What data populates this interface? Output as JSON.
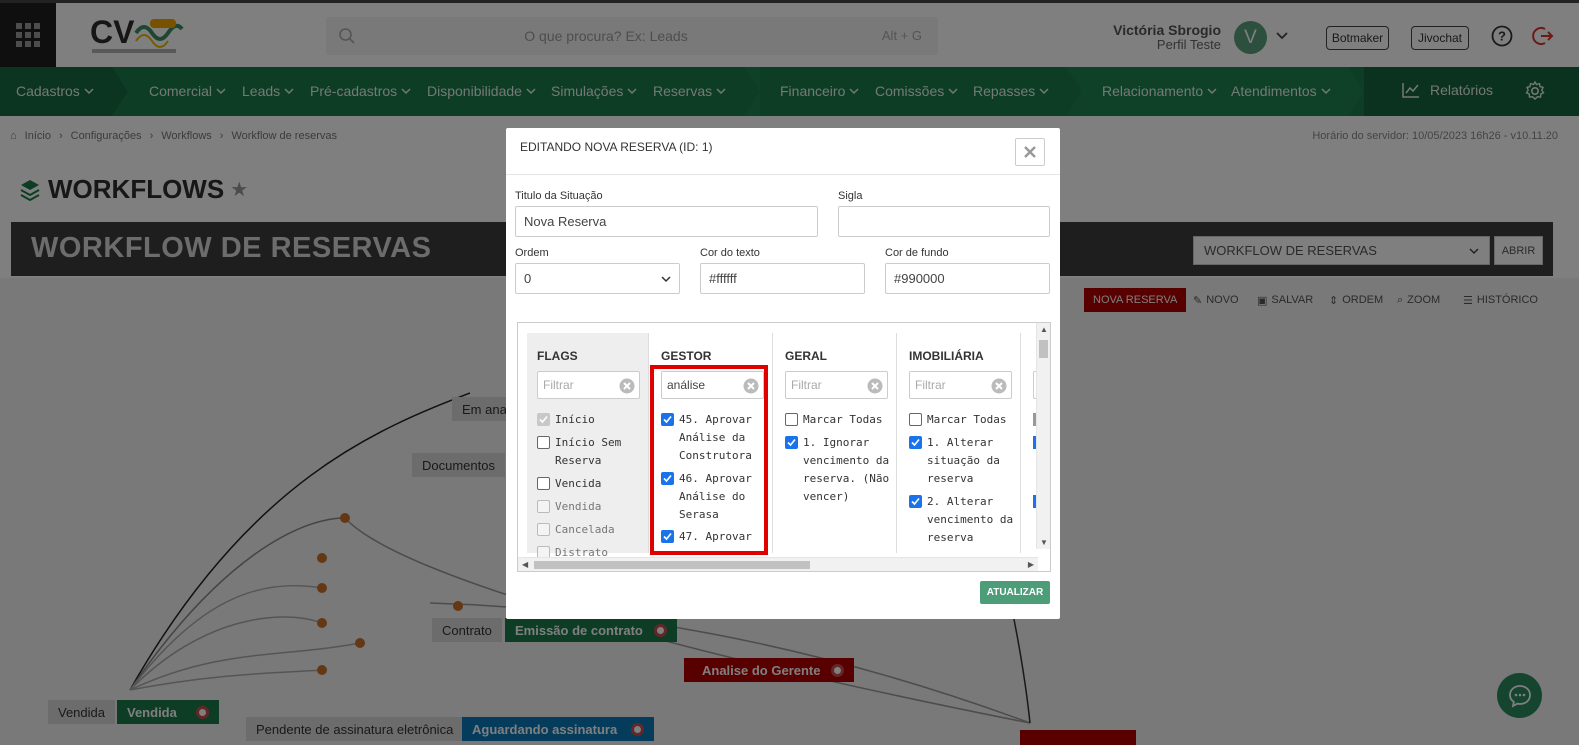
{
  "header": {
    "search_placeholder": "O que procura? Ex: Leads",
    "search_shortcut": "Alt + G",
    "user_name": "Victória Sbrogio",
    "user_profile": "Perfil Teste",
    "avatar_letter": "V",
    "botmaker_label": "Botmaker",
    "jivochat_label": "Jivochat"
  },
  "nav": {
    "items": [
      {
        "label": "Cadastros"
      },
      {
        "label": "Comercial"
      },
      {
        "label": "Leads"
      },
      {
        "label": "Pré-cadastros"
      },
      {
        "label": "Disponibilidade"
      },
      {
        "label": "Simulações"
      },
      {
        "label": "Reservas"
      },
      {
        "label": "Financeiro"
      },
      {
        "label": "Comissões"
      },
      {
        "label": "Repasses"
      },
      {
        "label": "Relacionamento"
      },
      {
        "label": "Atendimentos"
      }
    ],
    "reports_label": "Relatórios",
    "accent_color": "#1b7a4a"
  },
  "breadcrumb": {
    "items": [
      "Início",
      "Configurações",
      "Workflows",
      "Workflow de reservas"
    ]
  },
  "server_time": "Horário do servidor: 10/05/2023 16h26 - v10.11.20",
  "page": {
    "title": "WORKFLOWS",
    "workflow_title": "WORKFLOW DE RESERVAS",
    "workflow_select_value": "WORKFLOW DE RESERVAS",
    "open_label": "ABRIR"
  },
  "toolbar": {
    "new_reserva": "NOVA RESERVA",
    "novo": "NOVO",
    "salvar": "SALVAR",
    "ordem": "ORDEM",
    "zoom": "ZOOM",
    "historico": "HISTÓRICO"
  },
  "flow": {
    "nodes": [
      {
        "label": "Em anal",
        "type": "label"
      },
      {
        "label": "Documentos",
        "type": "label"
      },
      {
        "label": "Contrato",
        "type": "label"
      },
      {
        "label": "Emissão de contrato",
        "type": "status",
        "color": "#1b7a4a"
      },
      {
        "label": "Analise do Gerente",
        "type": "status",
        "color": "#b00000"
      },
      {
        "label": "Vendida",
        "type": "label"
      },
      {
        "label": "Vendida",
        "type": "status",
        "color": "#1b7a4a"
      },
      {
        "label": "Pendente de assinatura eletrônica",
        "type": "label"
      },
      {
        "label": "Aguardando assinatura",
        "type": "status",
        "color": "#0b79b8"
      }
    ]
  },
  "modal": {
    "title": "EDITANDO NOVA RESERVA (ID: 1)",
    "fields": {
      "titulo_label": "Titulo da Situação",
      "titulo_value": "Nova Reserva",
      "sigla_label": "Sigla",
      "sigla_value": "",
      "ordem_label": "Ordem",
      "ordem_value": "0",
      "cor_texto_label": "Cor do texto",
      "cor_texto_value": "#ffffff",
      "cor_fundo_label": "Cor de fundo",
      "cor_fundo_value": "#990000"
    },
    "columns": {
      "flags": {
        "title": "FLAGS",
        "filter_placeholder": "Filtrar",
        "filter_value": "",
        "items": [
          {
            "label": "Início",
            "checked": true,
            "disabled": true
          },
          {
            "label": "Início Sem Reserva",
            "checked": false,
            "disabled": false
          },
          {
            "label": "Vencida",
            "checked": false,
            "disabled": false
          },
          {
            "label": "Vendida",
            "checked": false,
            "disabled": true
          },
          {
            "label": "Cancelada",
            "checked": false,
            "disabled": true
          },
          {
            "label": "Distrato",
            "checked": false,
            "disabled": true
          }
        ]
      },
      "gestor": {
        "title": "GESTOR",
        "filter_placeholder": "Filtrar",
        "filter_value": "análise",
        "items": [
          {
            "label": "45. Aprovar Análise da Construtora",
            "checked": true
          },
          {
            "label": "46. Aprovar Análise do Serasa",
            "checked": true
          },
          {
            "label": "47. Aprovar",
            "checked": true
          }
        ]
      },
      "geral": {
        "title": "GERAL",
        "filter_placeholder": "Filtrar",
        "filter_value": "",
        "items": [
          {
            "label": "Marcar Todas",
            "checked": false
          },
          {
            "label": "1. Ignorar vencimento da reserva. (Não vencer)",
            "checked": true
          }
        ]
      },
      "imobiliaria": {
        "title": "IMOBILIÁRIA",
        "filter_placeholder": "Filtrar",
        "filter_value": "",
        "items": [
          {
            "label": "Marcar Todas",
            "checked": false
          },
          {
            "label": "1. Alterar situação da reserva",
            "checked": true
          },
          {
            "label": "2. Alterar vencimento da reserva",
            "checked": true
          }
        ]
      }
    },
    "update_label": "ATUALIZAR",
    "update_color": "#4c9d78"
  }
}
